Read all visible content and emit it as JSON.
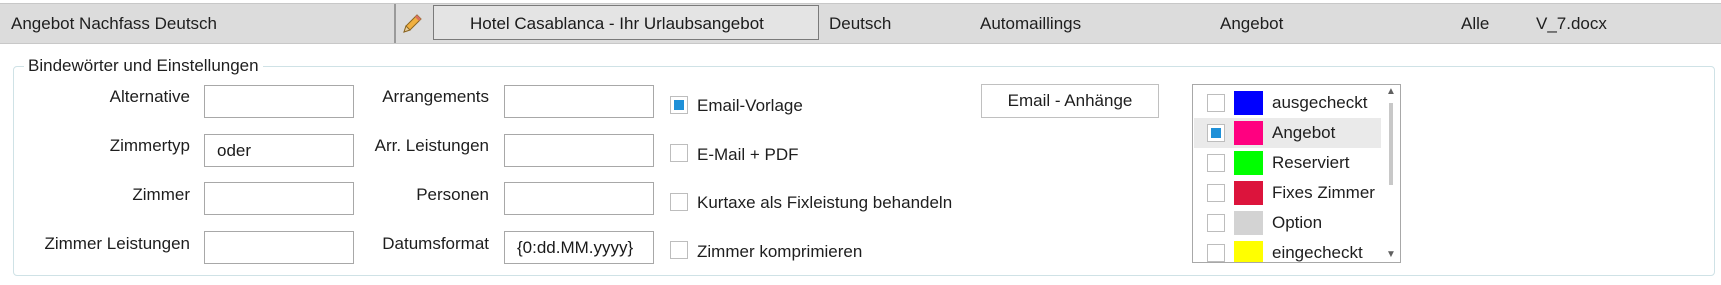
{
  "row": {
    "template_name": "Angebot Nachfass Deutsch",
    "edit_icon": "pencil-icon",
    "subject": "Hotel Casablanca - Ihr Urlaubsangebot",
    "language": "Deutsch",
    "category": "Automaillings",
    "type": "Angebot",
    "scope": "Alle",
    "file": "V_7.docx"
  },
  "group": {
    "title": "Bindewörter und Einstellungen",
    "fields": [
      {
        "label": "Alternative",
        "value": ""
      },
      {
        "label": "Zimmertyp",
        "value": "oder"
      },
      {
        "label": "Zimmer",
        "value": ""
      },
      {
        "label": "Zimmer Leistungen",
        "value": ""
      },
      {
        "label": "Arrangements",
        "value": ""
      },
      {
        "label": "Arr. Leistungen",
        "value": ""
      },
      {
        "label": "Personen",
        "value": ""
      },
      {
        "label": "Datumsformat",
        "value": "{0:dd.MM.yyyy}"
      }
    ],
    "options": [
      {
        "label": "Email-Vorlage",
        "checked": true
      },
      {
        "label": "E-Mail + PDF",
        "checked": false
      },
      {
        "label": "Kurtaxe als Fixleistung behandeln",
        "checked": false
      },
      {
        "label": "Zimmer komprimieren",
        "checked": false
      }
    ],
    "attachments_button": "Email - Anhänge",
    "status_list": [
      {
        "label": "ausgecheckt",
        "color": "#0000ff",
        "checked": false
      },
      {
        "label": "Angebot",
        "color": "#ff0080",
        "checked": true
      },
      {
        "label": "Reserviert",
        "color": "#00ff00",
        "checked": false
      },
      {
        "label": "Fixes Zimmer",
        "color": "#dc143c",
        "checked": false
      },
      {
        "label": "Option",
        "color": "#d3d3d3",
        "checked": false
      },
      {
        "label": "eingecheckt",
        "color": "#ffff00",
        "checked": false
      }
    ]
  }
}
